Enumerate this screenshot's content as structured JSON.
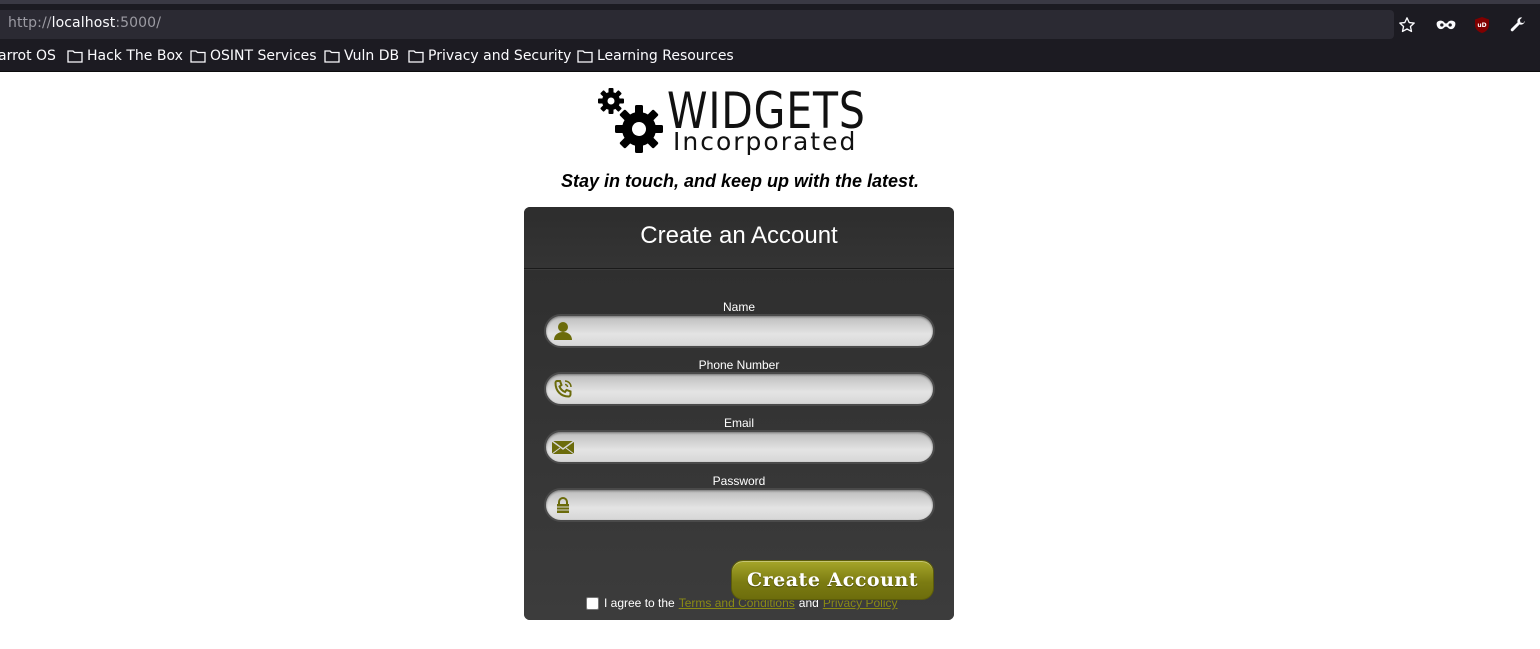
{
  "browser": {
    "url_prefix": "http://",
    "url_host": "localhost",
    "url_suffix": ":5000/",
    "bookmarks": [
      {
        "label": "arrot OS"
      },
      {
        "label": "Hack The Box"
      },
      {
        "label": "OSINT Services"
      },
      {
        "label": "Vuln DB"
      },
      {
        "label": "Privacy and Security"
      },
      {
        "label": "Learning Resources"
      }
    ],
    "icons": [
      "star-icon",
      "mask-icon",
      "ublock-icon",
      "wrench-icon"
    ]
  },
  "logo": {
    "title": "WIDGETS",
    "subtitle": "Incorporated"
  },
  "tagline": "Stay in touch, and keep up with the latest.",
  "form": {
    "title": "Create an Account",
    "fields": [
      {
        "label": "Name",
        "value": "",
        "icon": "person-icon"
      },
      {
        "label": "Phone Number",
        "value": "",
        "icon": "phone-icon"
      },
      {
        "label": "Email",
        "value": "",
        "icon": "envelope-icon"
      },
      {
        "label": "Password",
        "value": "",
        "icon": "lock-icon"
      }
    ],
    "agree_prefix": "I agree to the",
    "terms_link": "Terms and Conditions",
    "agree_and": "and",
    "privacy_link": "Privacy Policy",
    "agree_checked": false,
    "submit_label": "Create Account"
  },
  "colors": {
    "accent": "#7c7c12",
    "link": "#8a8a14",
    "card": "#3b3b3b",
    "icon": "#6b6b0b"
  }
}
